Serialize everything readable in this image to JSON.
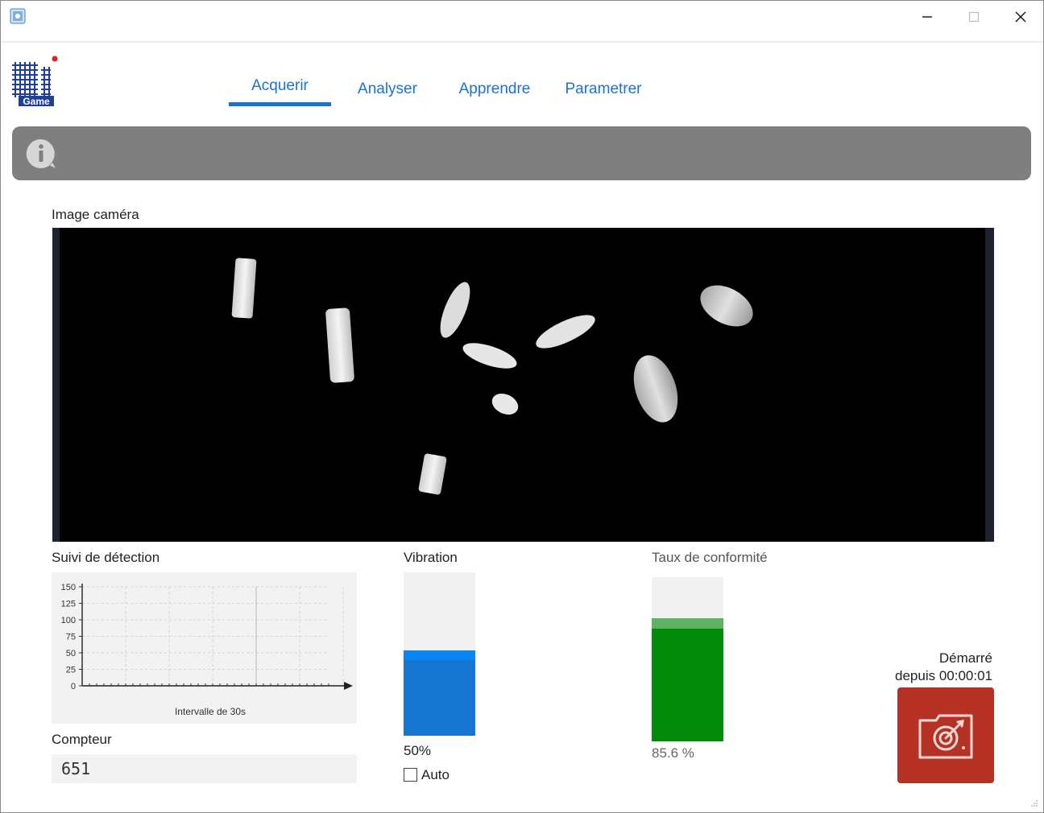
{
  "window": {
    "title_icon": "app-icon",
    "controls": [
      "minimize-icon",
      "maximize-icon",
      "close-icon"
    ]
  },
  "logo": {
    "text": "Qi",
    "subtext": "Game"
  },
  "tabs": [
    {
      "label": "Acquerir",
      "active": true
    },
    {
      "label": "Analyser",
      "active": false
    },
    {
      "label": "Apprendre",
      "active": false
    },
    {
      "label": "Parametrer",
      "active": false
    }
  ],
  "info_bar": {
    "icon": "info-icon",
    "message": ""
  },
  "camera": {
    "label": "Image caméra"
  },
  "detection": {
    "label": "Suivi de détection",
    "chart_data": {
      "type": "line",
      "title": "",
      "xlabel": "Intervalle de 30s",
      "ylabel": "",
      "yticks": [
        0,
        25,
        50,
        75,
        100,
        125,
        150
      ],
      "ylim": [
        0,
        150
      ],
      "grid": true,
      "series": []
    }
  },
  "counter": {
    "label": "Compteur",
    "value": "651"
  },
  "vibration": {
    "label": "Vibration",
    "percent_text": "50%",
    "level": 0.52,
    "auto_label": "Auto",
    "auto_checked": false
  },
  "conformity": {
    "label": "Taux de conformité",
    "percent_text": "85.6 %",
    "level": 0.75
  },
  "status": {
    "line1": "Démarré",
    "line2": "depuis 00:00:01"
  },
  "start_button": {
    "icon": "camera-target-icon"
  },
  "colors": {
    "accent": "#1a73d1",
    "info_bar": "#7f7f7f",
    "vibration": "#1676d2",
    "conformity": "#038a0a",
    "start_button": "#b53124"
  }
}
